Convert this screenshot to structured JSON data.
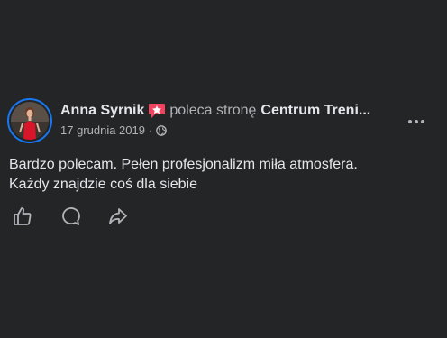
{
  "post": {
    "author": "Anna Syrnik",
    "badge_icon": "recommend-star-icon",
    "recommends_text": "poleca stronę",
    "page_name": "Centrum Treni...",
    "date": "17 grudnia 2019",
    "separator": "·",
    "privacy_icon": "globe-icon",
    "more_icon": "more-options-icon",
    "body_line1": "Bardzo polecam. Pełen profesjonalizm miła atmosfera.",
    "body_line2": "Każdy znajdzie coś dla siebie"
  },
  "actions": [
    {
      "icon": "like-icon"
    },
    {
      "icon": "comment-icon"
    },
    {
      "icon": "share-icon"
    }
  ],
  "colors": {
    "background": "#242526",
    "primary_text": "#e4e6eb",
    "secondary_text": "#b0b3b8",
    "avatar_ring": "#1877f2",
    "badge": "#f3425f"
  }
}
